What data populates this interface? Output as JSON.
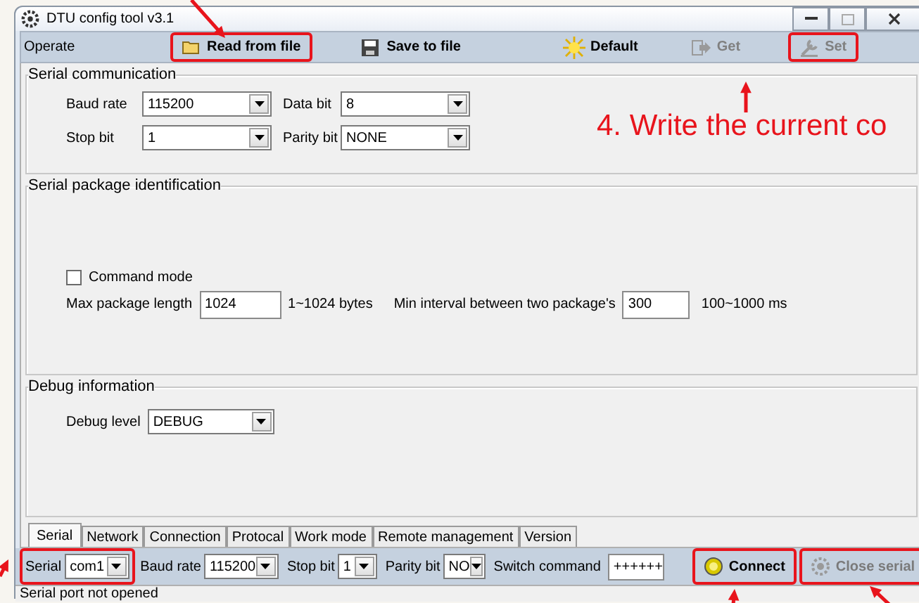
{
  "window": {
    "title": "DTU config tool v3.1"
  },
  "toolbar": {
    "label": "Operate",
    "buttons": [
      {
        "kind": "folder",
        "label": "Read from file",
        "disabled": false,
        "highlighted": true
      },
      {
        "kind": "save",
        "label": "Save to file",
        "disabled": false,
        "highlighted": false
      },
      {
        "kind": "default",
        "label": "Default",
        "disabled": false,
        "highlighted": false
      },
      {
        "kind": "get",
        "label": "Get",
        "disabled": true,
        "highlighted": false
      },
      {
        "kind": "set",
        "label": "Set",
        "disabled": true,
        "highlighted": true
      }
    ]
  },
  "annotation": {
    "text": "4. Write the current co"
  },
  "serial_communication": {
    "title": "Serial communication",
    "fields": [
      {
        "label": "Baud rate",
        "value": "115200"
      },
      {
        "label": "Data bit",
        "value": "8"
      },
      {
        "label": "Stop bit",
        "value": "1"
      },
      {
        "label": "Parity bit",
        "value": "NONE"
      }
    ]
  },
  "package_identification": {
    "title": "Serial package identification",
    "command_mode": {
      "label": "Command mode",
      "checked": false
    },
    "max_length": {
      "label": "Max package length",
      "value": "1024",
      "range": "1~1024 bytes"
    },
    "min_interval": {
      "label": "Min interval between two package's",
      "value": "300",
      "range": "100~1000 ms"
    }
  },
  "debug": {
    "title": "Debug information",
    "label": "Debug level",
    "value": "DEBUG"
  },
  "tabs": [
    {
      "label": "Serial",
      "selected": true
    },
    {
      "label": "Network",
      "selected": false
    },
    {
      "label": "Connection",
      "selected": false
    },
    {
      "label": "Protocal",
      "selected": false
    },
    {
      "label": "Work mode",
      "selected": false
    },
    {
      "label": "Remote management",
      "selected": false
    },
    {
      "label": "Version",
      "selected": false
    }
  ],
  "connection_bar": {
    "fields": [
      {
        "kind": "combo",
        "label": "Serial",
        "value": "com1",
        "highlighted": true
      },
      {
        "kind": "combo",
        "label": "Baud rate",
        "value": "115200",
        "highlighted": false
      },
      {
        "kind": "combo",
        "label": "Stop bit",
        "value": "1",
        "highlighted": false
      },
      {
        "kind": "combo",
        "label": "Parity bit",
        "value": "NO",
        "highlighted": false
      },
      {
        "kind": "text",
        "label": "Switch command",
        "value": "++++++",
        "highlighted": false
      }
    ],
    "buttons": [
      {
        "kind": "connect",
        "label": "Connect",
        "disabled": false,
        "highlighted": true
      },
      {
        "kind": "close",
        "label": "Close serial",
        "disabled": true,
        "highlighted": true
      }
    ]
  },
  "status_bar": {
    "text": "Serial port not opened"
  }
}
